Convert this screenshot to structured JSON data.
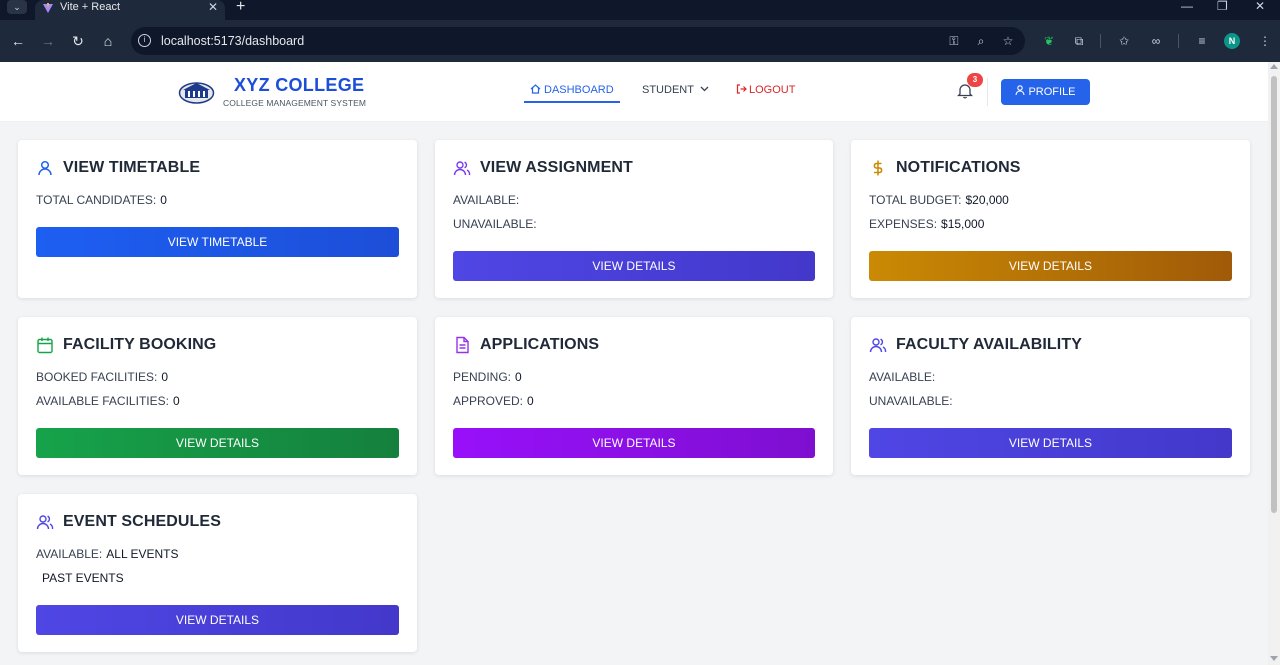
{
  "browser": {
    "tab_title": "Vite + React",
    "url": "localhost:5173/dashboard",
    "profile_initial": "N"
  },
  "header": {
    "brand_name": "XYZ COLLEGE",
    "brand_sub": "COLLEGE MANAGEMENT SYSTEM",
    "nav": {
      "dashboard": "DASHBOARD",
      "student": "STUDENT",
      "logout": "LOGOUT"
    },
    "notification_count": "3",
    "profile_label": "PROFILE"
  },
  "colors": {
    "accent": "#2563eb",
    "logout": "#dc2626",
    "timetable_btn": "#1d4ed8",
    "indigo_btn": "#4f46e5",
    "amber_btn": "#b45309",
    "green_btn": "#16a34a",
    "purple_btn": "#9333ea"
  },
  "cards": [
    {
      "title": "VIEW TIMETABLE",
      "icon": "user-icon",
      "lines": [
        {
          "label": "TOTAL CANDIDATES:",
          "value": "0"
        }
      ],
      "button": "VIEW TIMETABLE"
    },
    {
      "title": "VIEW ASSIGNMENT",
      "icon": "users-icon",
      "lines": [
        {
          "label": "AVAILABLE:",
          "value": ""
        },
        {
          "label": "UNAVAILABLE:",
          "value": ""
        }
      ],
      "button": "VIEW DETAILS"
    },
    {
      "title": "NOTIFICATIONS",
      "icon": "dollar-icon",
      "lines": [
        {
          "label": "TOTAL BUDGET:",
          "value": "$20,000"
        },
        {
          "label": "EXPENSES:",
          "value": "$15,000"
        }
      ],
      "button": "VIEW DETAILS"
    },
    {
      "title": "FACILITY BOOKING",
      "icon": "calendar-icon",
      "lines": [
        {
          "label": "BOOKED FACILITIES:",
          "value": "0"
        },
        {
          "label": "AVAILABLE FACILITIES:",
          "value": "0"
        }
      ],
      "button": "VIEW DETAILS"
    },
    {
      "title": "APPLICATIONS",
      "icon": "document-icon",
      "lines": [
        {
          "label": "PENDING:",
          "value": "0"
        },
        {
          "label": "APPROVED:",
          "value": "0"
        }
      ],
      "button": "VIEW DETAILS"
    },
    {
      "title": "FACULTY AVAILABILITY",
      "icon": "users-icon",
      "lines": [
        {
          "label": "AVAILABLE:",
          "value": ""
        },
        {
          "label": "UNAVAILABLE:",
          "value": ""
        }
      ],
      "button": "VIEW DETAILS"
    },
    {
      "title": "EVENT SCHEDULES",
      "icon": "users-icon",
      "lines": [
        {
          "label": "AVAILABLE:",
          "value": "ALL EVENTS"
        },
        {
          "label": "",
          "value": "PAST EVENTS"
        }
      ],
      "button": "VIEW DETAILS"
    }
  ]
}
